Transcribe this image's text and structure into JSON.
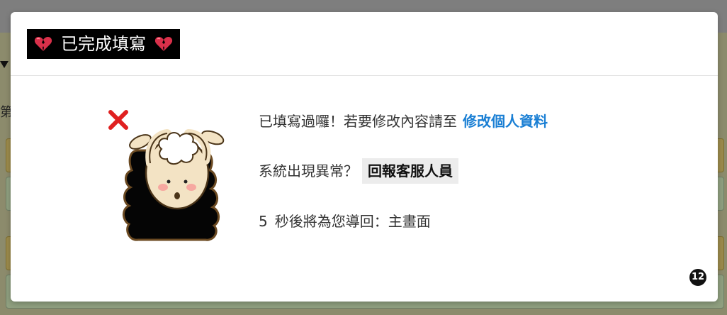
{
  "background": {
    "side_char": "第"
  },
  "modal": {
    "title": "已完成填寫",
    "title_icon": "broken-heart-icon",
    "illustration_icon": "sheep-x-icon",
    "line1": {
      "text": "已填寫過囉！若要修改內容請至",
      "link_label": "修改個人資料"
    },
    "line2": {
      "text": "系統出現異常？",
      "button_label": "回報客服人員"
    },
    "line3": {
      "seconds": "5",
      "text": "秒後將為您導回：主畫面"
    },
    "badge": "12"
  },
  "colors": {
    "link": "#1a7fd4",
    "title_bg": "#000000",
    "x_mark": "#e02020"
  }
}
